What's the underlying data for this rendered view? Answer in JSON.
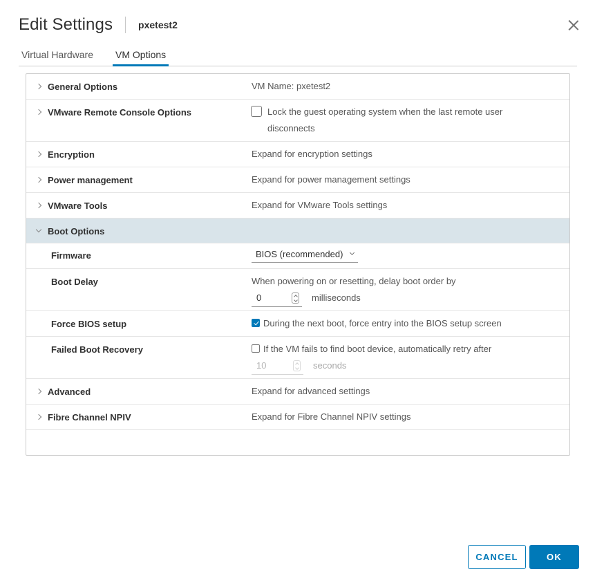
{
  "header": {
    "title": "Edit Settings",
    "vm_name": "pxetest2"
  },
  "tabs": [
    {
      "label": "Virtual Hardware",
      "active": false
    },
    {
      "label": "VM Options",
      "active": true
    }
  ],
  "sections": {
    "general": {
      "label": "General Options",
      "value": "VM Name: pxetest2"
    },
    "vmrc": {
      "label": "VMware Remote Console Options",
      "checkbox_label_line1": "Lock the guest operating system when the last remote user",
      "checkbox_label_line2": "disconnects",
      "checked": false
    },
    "encryption": {
      "label": "Encryption",
      "value": "Expand for encryption settings"
    },
    "power": {
      "label": "Power management",
      "value": "Expand for power management settings"
    },
    "tools": {
      "label": "VMware Tools",
      "value": "Expand for VMware Tools settings"
    },
    "boot": {
      "label": "Boot Options",
      "firmware": {
        "label": "Firmware",
        "value": "BIOS (recommended)"
      },
      "boot_delay": {
        "label": "Boot Delay",
        "description": "When powering on or resetting, delay boot order by",
        "value": "0",
        "unit": "milliseconds"
      },
      "force_bios": {
        "label": "Force BIOS setup",
        "checkbox_label": "During the next boot, force entry into the BIOS setup screen",
        "checked": true
      },
      "failed_recovery": {
        "label": "Failed Boot Recovery",
        "checkbox_label": "If the VM fails to find boot device, automatically retry after",
        "checked": false,
        "value": "10",
        "unit": "seconds"
      }
    },
    "advanced": {
      "label": "Advanced",
      "value": "Expand for advanced settings"
    },
    "npiv": {
      "label": "Fibre Channel NPIV",
      "value": "Expand for Fibre Channel NPIV settings"
    }
  },
  "footer": {
    "cancel_label": "CANCEL",
    "ok_label": "OK"
  },
  "colors": {
    "accent": "#0079b8",
    "expanded_row_bg": "#d9e4ea"
  }
}
